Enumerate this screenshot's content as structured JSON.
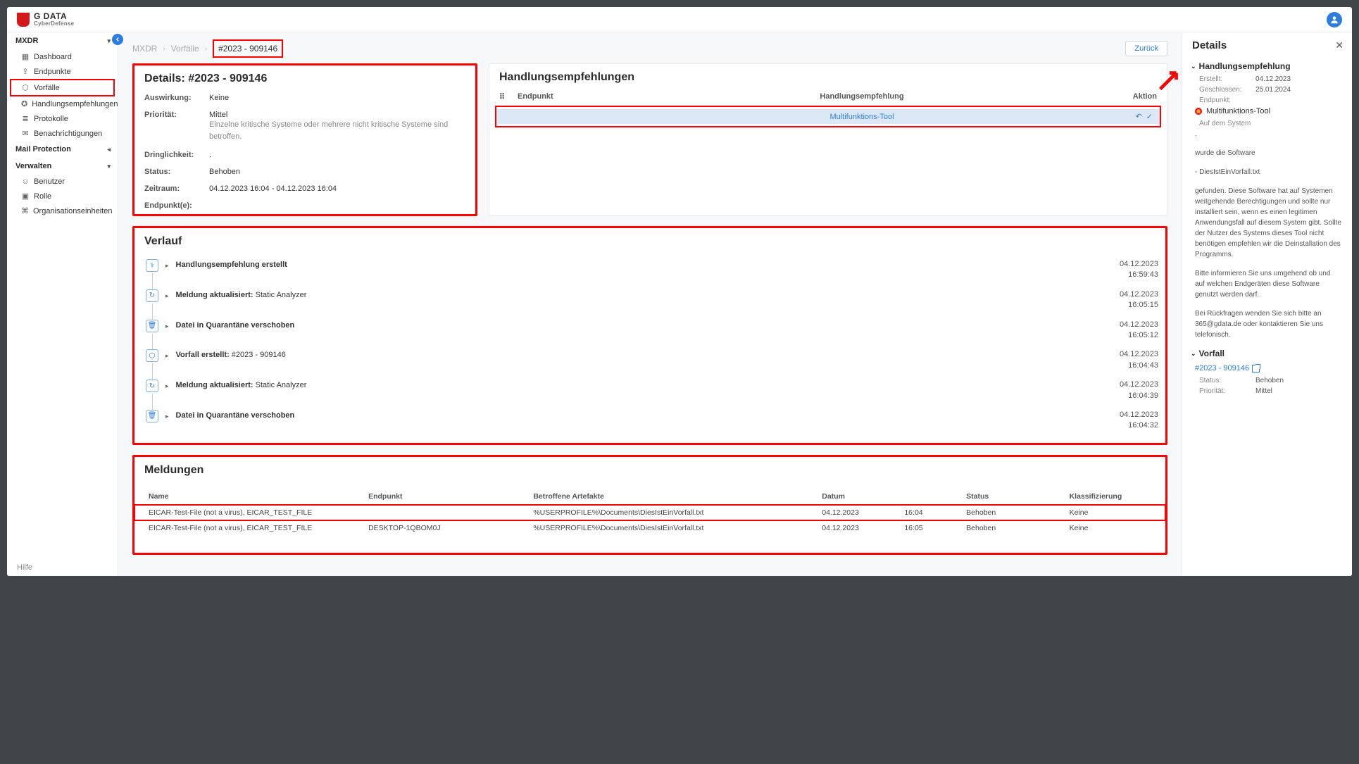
{
  "brand": {
    "name": "G DATA",
    "sub": "CyberDefense"
  },
  "sidebar": {
    "groups": [
      {
        "title": "MXDR",
        "items": [
          {
            "label": "Dashboard",
            "icon": "▦"
          },
          {
            "label": "Endpunkte",
            "icon": "⇪"
          },
          {
            "label": "Vorfälle",
            "icon": "⬡",
            "active": true
          },
          {
            "label": "Handlungsempfehlungen",
            "icon": "✪"
          },
          {
            "label": "Protokolle",
            "icon": "≣"
          },
          {
            "label": "Benachrichtigungen",
            "icon": "✉"
          }
        ]
      },
      {
        "title": "Mail Protection",
        "caret": "left",
        "items": []
      },
      {
        "title": "Verwalten",
        "items": [
          {
            "label": "Benutzer",
            "icon": "☺"
          },
          {
            "label": "Rolle",
            "icon": "▣"
          },
          {
            "label": "Organisationseinheiten",
            "icon": "⌘"
          }
        ]
      }
    ],
    "help": "Hilfe"
  },
  "breadcrumb": {
    "items": [
      "MXDR",
      "Vorfälle",
      "#2023 - 909146"
    ],
    "back": "Zurück"
  },
  "details_card": {
    "title": "Details: #2023 - 909146",
    "rows": [
      {
        "k": "Auswirkung:",
        "v": "Keine"
      },
      {
        "k": "Priorität:",
        "v": "Mittel",
        "sub": "Einzelne kritische Systeme oder mehrere nicht kritische Systeme sind betroffen."
      },
      {
        "k": "Dringlichkeit:",
        "v": "."
      },
      {
        "k": "Status:",
        "v": "Behoben"
      },
      {
        "k": "Zeitraum:",
        "v": "04.12.2023 16:04 - 04.12.2023 16:04"
      },
      {
        "k": "Endpunkt(e):",
        "v": ""
      }
    ]
  },
  "rec_card": {
    "title": "Handlungsempfehlungen",
    "cols": {
      "endpoint": "Endpunkt",
      "rec": "Handlungsempfehlung",
      "action": "Aktion"
    },
    "row": {
      "endpoint": "",
      "rec": "Multifunktions-Tool"
    }
  },
  "verlauf": {
    "title": "Verlauf",
    "items": [
      {
        "icon": "⚕",
        "b": "Handlungsempfehlung erstellt",
        "t": "",
        "d": "04.12.2023",
        "tm": "16:59:43"
      },
      {
        "icon": "↻",
        "b": "Meldung aktualisiert:",
        "t": "Static Analyzer",
        "d": "04.12.2023",
        "tm": "16:05:15"
      },
      {
        "icon": "🗑",
        "b": "Datei in Quarantäne verschoben",
        "t": "",
        "d": "04.12.2023",
        "tm": "16:05:12"
      },
      {
        "icon": "⬡",
        "b": "Vorfall erstellt:",
        "t": "#2023 - 909146",
        "d": "04.12.2023",
        "tm": "16:04:43"
      },
      {
        "icon": "↻",
        "b": "Meldung aktualisiert:",
        "t": "Static Analyzer",
        "d": "04.12.2023",
        "tm": "16:04:39"
      },
      {
        "icon": "🗑",
        "b": "Datei in Quarantäne verschoben",
        "t": "",
        "d": "04.12.2023",
        "tm": "16:04:32"
      }
    ]
  },
  "meld": {
    "title": "Meldungen",
    "cols": [
      "Name",
      "Endpunkt",
      "Betroffene Artefakte",
      "Datum",
      "",
      "Status",
      "Klassifizierung"
    ],
    "rows": [
      {
        "name": "EICAR-Test-File (not a virus), EICAR_TEST_FILE",
        "ep": "",
        "art": "%USERPROFILE%\\Documents\\DiesIstEinVorfall.txt",
        "date": "04.12.2023",
        "time": "16:04",
        "status": "Behoben",
        "cls": "Keine",
        "hl": true
      },
      {
        "name": "EICAR-Test-File (not a virus), EICAR_TEST_FILE",
        "ep": "DESKTOP-1QBOM0J",
        "art": "%USERPROFILE%\\Documents\\DiesIstEinVorfall.txt",
        "date": "04.12.2023",
        "time": "16:05",
        "status": "Behoben",
        "cls": "Keine"
      }
    ]
  },
  "panel": {
    "title": "Details",
    "sec1": {
      "title": "Handlungsempfehlung",
      "kv": [
        {
          "k": "Erstellt:",
          "v": "04.12.2023"
        },
        {
          "k": "Geschlossen:",
          "v": "25.01.2024"
        },
        {
          "k": "Endpunkt:",
          "v": ""
        }
      ],
      "chip": "Multifunktions-Tool",
      "small": "Auf dem System",
      "dot": ".",
      "p1": "wurde die Software",
      "p2": "- DiesIstEinVorfall.txt",
      "p3": "gefunden. Diese Software hat auf Systemen weitgehende Berechtigungen und sollte nur installiert sein, wenn es einen legitimen Anwendungsfall auf diesem System gibt. Sollte der Nutzer des Systems dieses Tool nicht benötigen empfehlen wir die Deinstallation des Programms.",
      "p4": "Bitte informieren Sie uns umgehend ob und auf welchen Endgeräten diese Software genutzt werden darf.",
      "p5": "Bei Rückfragen wenden Sie sich bitte an 365@gdata.de oder kontaktieren Sie uns telefonisch."
    },
    "sec2": {
      "title": "Vorfall",
      "link": "#2023 - 909146",
      "kv": [
        {
          "k": "Status:",
          "v": "Behoben"
        },
        {
          "k": "Priorität:",
          "v": "Mittel"
        }
      ]
    }
  }
}
